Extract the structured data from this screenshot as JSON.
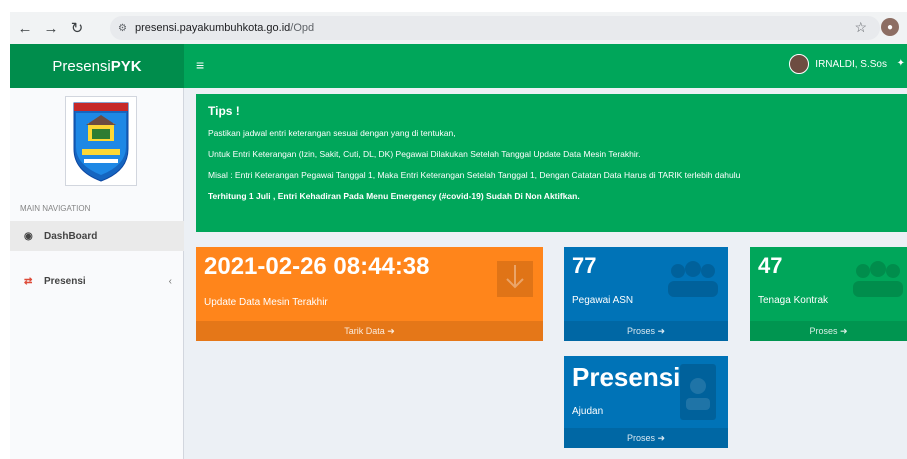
{
  "browser": {
    "url_host": "presensi.payakumbuhkota.go.id",
    "url_path": "/Opd"
  },
  "header": {
    "logo_prefix": "Presensi",
    "logo_suffix": "PYK",
    "user_name": "IRNALDI, S.Sos"
  },
  "sidebar": {
    "nav_heading": "MAIN NAVIGATION",
    "items": [
      {
        "label": "DashBoard",
        "icon": "dashboard-icon"
      },
      {
        "label": "Presensi",
        "icon": "exchange-icon"
      }
    ]
  },
  "tips": {
    "title": "Tips !",
    "lines": [
      "Pastikan jadwal entri keterangan sesuai dengan yang di tentukan,",
      "Untuk Entri Keterangan (Izin, Sakit, Cuti, DL, DK) Pegawai Dilakukan Setelah Tanggal Update Data Mesin Terakhir.",
      "Misal : Entri Keterangan Pegawai Tanggal 1, Maka Entri Keterangan Setelah Tanggal 1, Dengan Catatan Data Harus di TARIK terlebih dahulu"
    ],
    "notice": "Terhitung 1 Juli , Entri Kehadiran Pada Menu Emergency (#covid-19) Sudah Di Non Aktifkan."
  },
  "boxes": {
    "update": {
      "value": "2021-02-26 08:44:38",
      "label": "Update Data Mesin Terakhir",
      "footer": "Tarik Data"
    },
    "asn": {
      "value": "77",
      "label": "Pegawai ASN",
      "footer": "Proses"
    },
    "kontrak": {
      "value": "47",
      "label": "Tenaga Kontrak",
      "footer": "Proses"
    },
    "presensi": {
      "value": "Presensi",
      "label": "Ajudan",
      "footer": "Proses"
    }
  },
  "colors": {
    "green": "#00a65a",
    "green_dark": "#008d4c",
    "orange": "#ff851b",
    "blue": "#0073b7"
  }
}
